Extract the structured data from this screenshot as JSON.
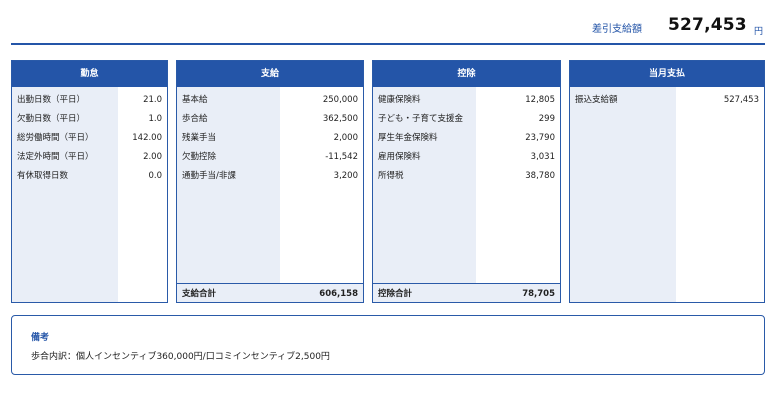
{
  "header": {
    "net_label": "差引支給額",
    "net_value": "527,453",
    "net_unit": "円"
  },
  "attendance": {
    "title": "勤怠",
    "rows": [
      {
        "label": "出勤日数（平日）",
        "value": "21.0"
      },
      {
        "label": "欠勤日数（平日）",
        "value": "1.0"
      },
      {
        "label": "総労働時間（平日）",
        "value": "142.00"
      },
      {
        "label": "法定外時間（平日）",
        "value": "2.00"
      },
      {
        "label": "有休取得日数",
        "value": "0.0"
      }
    ]
  },
  "payment": {
    "title": "支給",
    "rows": [
      {
        "label": "基本給",
        "value": "250,000"
      },
      {
        "label": "歩合給",
        "value": "362,500"
      },
      {
        "label": "残業手当",
        "value": "2,000"
      },
      {
        "label": "欠勤控除",
        "value": "-11,542"
      },
      {
        "label": "通勤手当/非課",
        "value": "3,200"
      }
    ],
    "total_label": "支給合計",
    "total_value": "606,158"
  },
  "deduction": {
    "title": "控除",
    "rows": [
      {
        "label": "健康保険料",
        "value": "12,805"
      },
      {
        "label": "子ども・子育て支援金",
        "value": "299"
      },
      {
        "label": "厚生年金保険料",
        "value": "23,790"
      },
      {
        "label": "雇用保険料",
        "value": "3,031"
      },
      {
        "label": "所得税",
        "value": "38,780"
      }
    ],
    "total_label": "控除合計",
    "total_value": "78,705"
  },
  "monthly": {
    "title": "当月支払",
    "rows": [
      {
        "label": "振込支給額",
        "value": "527,453"
      }
    ]
  },
  "remarks": {
    "title": "備考",
    "text": "歩合内訳：個人インセンティブ360,000円/口コミインセンティブ2,500円"
  },
  "colors": {
    "accent": "#2455a8",
    "label_bg": "#e9eef7"
  }
}
